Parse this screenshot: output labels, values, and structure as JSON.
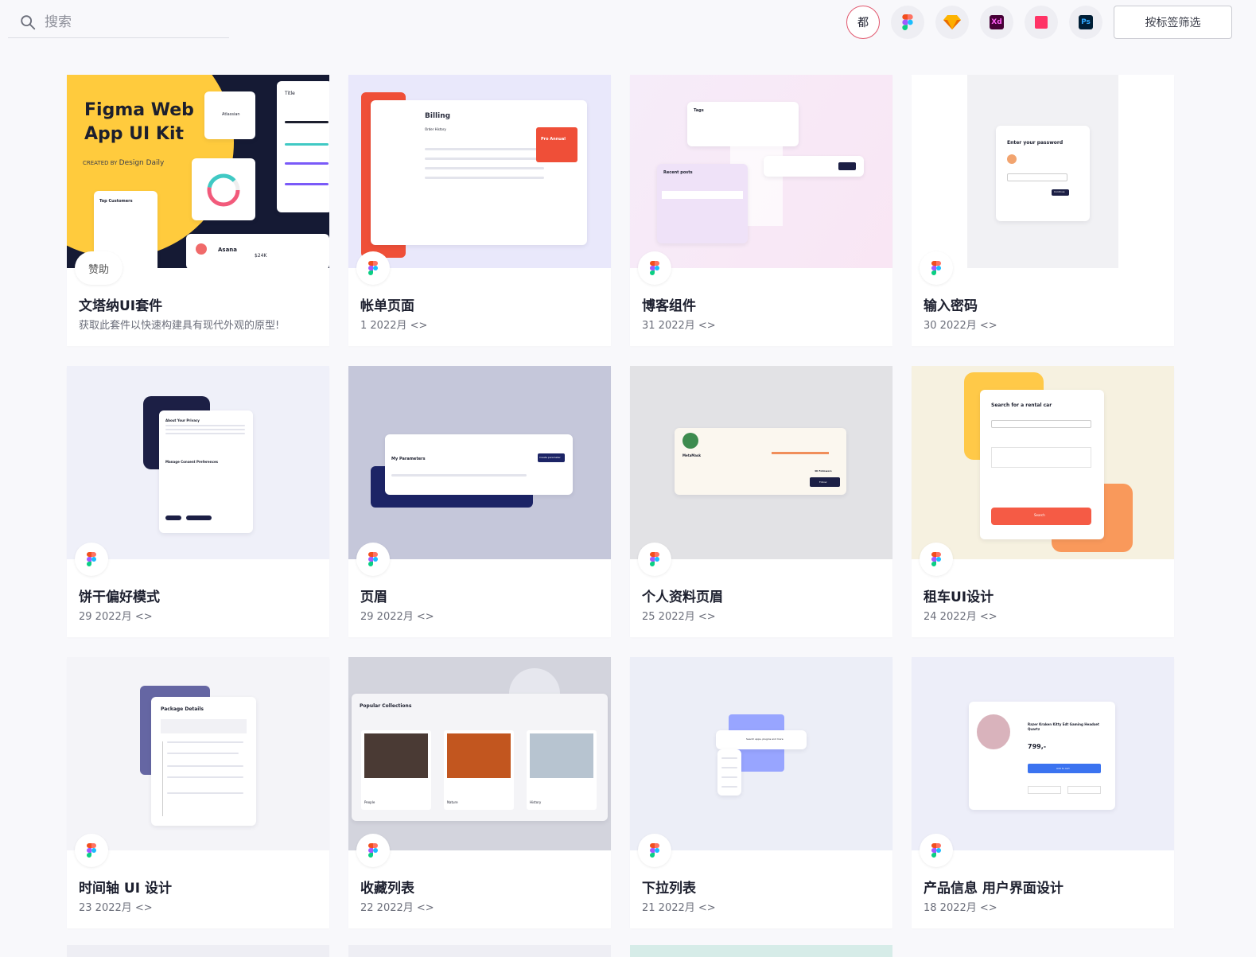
{
  "search": {
    "placeholder": "搜索",
    "icon": "search-icon"
  },
  "filters": [
    {
      "label": "都",
      "icon": "all",
      "active": true
    },
    {
      "label": "",
      "icon": "figma-icon"
    },
    {
      "label": "",
      "icon": "sketch-icon"
    },
    {
      "label": "Xd",
      "icon": "xd-icon"
    },
    {
      "label": "",
      "icon": "invision-icon"
    },
    {
      "label": "Ps",
      "icon": "photoshop-icon"
    }
  ],
  "tag_filter_label": "按标签筛选",
  "colors": {
    "accent": "#e1586e",
    "xd": "#470137",
    "ps": "#001e36",
    "sketch": "#fdb300",
    "invision": "#ff3366"
  },
  "cards": [
    {
      "title": "文塔纳UI套件",
      "meta": "获取此套件以快速构建具有现代外观的原型!",
      "badge": "赞助",
      "thumb": {
        "heading": "Figma Web App UI Kit",
        "sub": "CREATED BY",
        "brand": "Design Daily",
        "tile1": "Atlassian",
        "tile2": "Top Customers",
        "tile3": "Asana",
        "amount": "$24K",
        "label": "Title"
      }
    },
    {
      "title": "帐单页面",
      "meta": "1 2022月 <>",
      "badge": "figma",
      "thumb": {
        "heading": "Billing",
        "sub": "Order History",
        "plan": "Pro Annual"
      }
    },
    {
      "title": "博客组件",
      "meta": "31 2022月 <>",
      "badge": "figma",
      "thumb": {
        "heading": "Tags",
        "sub": "Recent posts"
      }
    },
    {
      "title": "输入密码",
      "meta": "30 2022月 <>",
      "badge": "figma",
      "thumb": {
        "heading": "Enter your password",
        "button": "Continue"
      }
    },
    {
      "title": "饼干偏好模式",
      "meta": "29 2022月 <>",
      "badge": "figma",
      "thumb": {
        "heading": "About Your Privacy",
        "sub": "Manage Consent Preferences"
      }
    },
    {
      "title": "页眉",
      "meta": "29 2022月 <>",
      "badge": "figma",
      "thumb": {
        "heading": "My Parameters",
        "button": "Create parameter"
      }
    },
    {
      "title": "个人资料页眉",
      "meta": "25 2022月 <>",
      "badge": "figma",
      "thumb": {
        "heading": "MetaMask",
        "sub": "4K Followers",
        "button": "Follow"
      }
    },
    {
      "title": "租车UI设计",
      "meta": "24 2022月 <>",
      "badge": "figma",
      "thumb": {
        "heading": "Search for a rental car",
        "button": "Search"
      }
    },
    {
      "title": "时间轴 UI 设计",
      "meta": "23 2022月 <>",
      "badge": "figma",
      "thumb": {
        "heading": "Package Details"
      }
    },
    {
      "title": "收藏列表",
      "meta": "22 2022月 <>",
      "badge": "figma",
      "thumb": {
        "heading": "Popular Collections",
        "items": [
          "People",
          "Nature",
          "History"
        ]
      }
    },
    {
      "title": "下拉列表",
      "meta": "21 2022月 <>",
      "badge": "figma",
      "thumb": {
        "heading": "Search apps, plugins and more"
      }
    },
    {
      "title": "产品信息 用户界面设计",
      "meta": "18 2022月 <>",
      "badge": "figma",
      "thumb": {
        "heading": "Razer Kraken Kitty Edt Gaming Headset Quartz",
        "price": "799,-",
        "button": "Add to cart"
      }
    }
  ]
}
